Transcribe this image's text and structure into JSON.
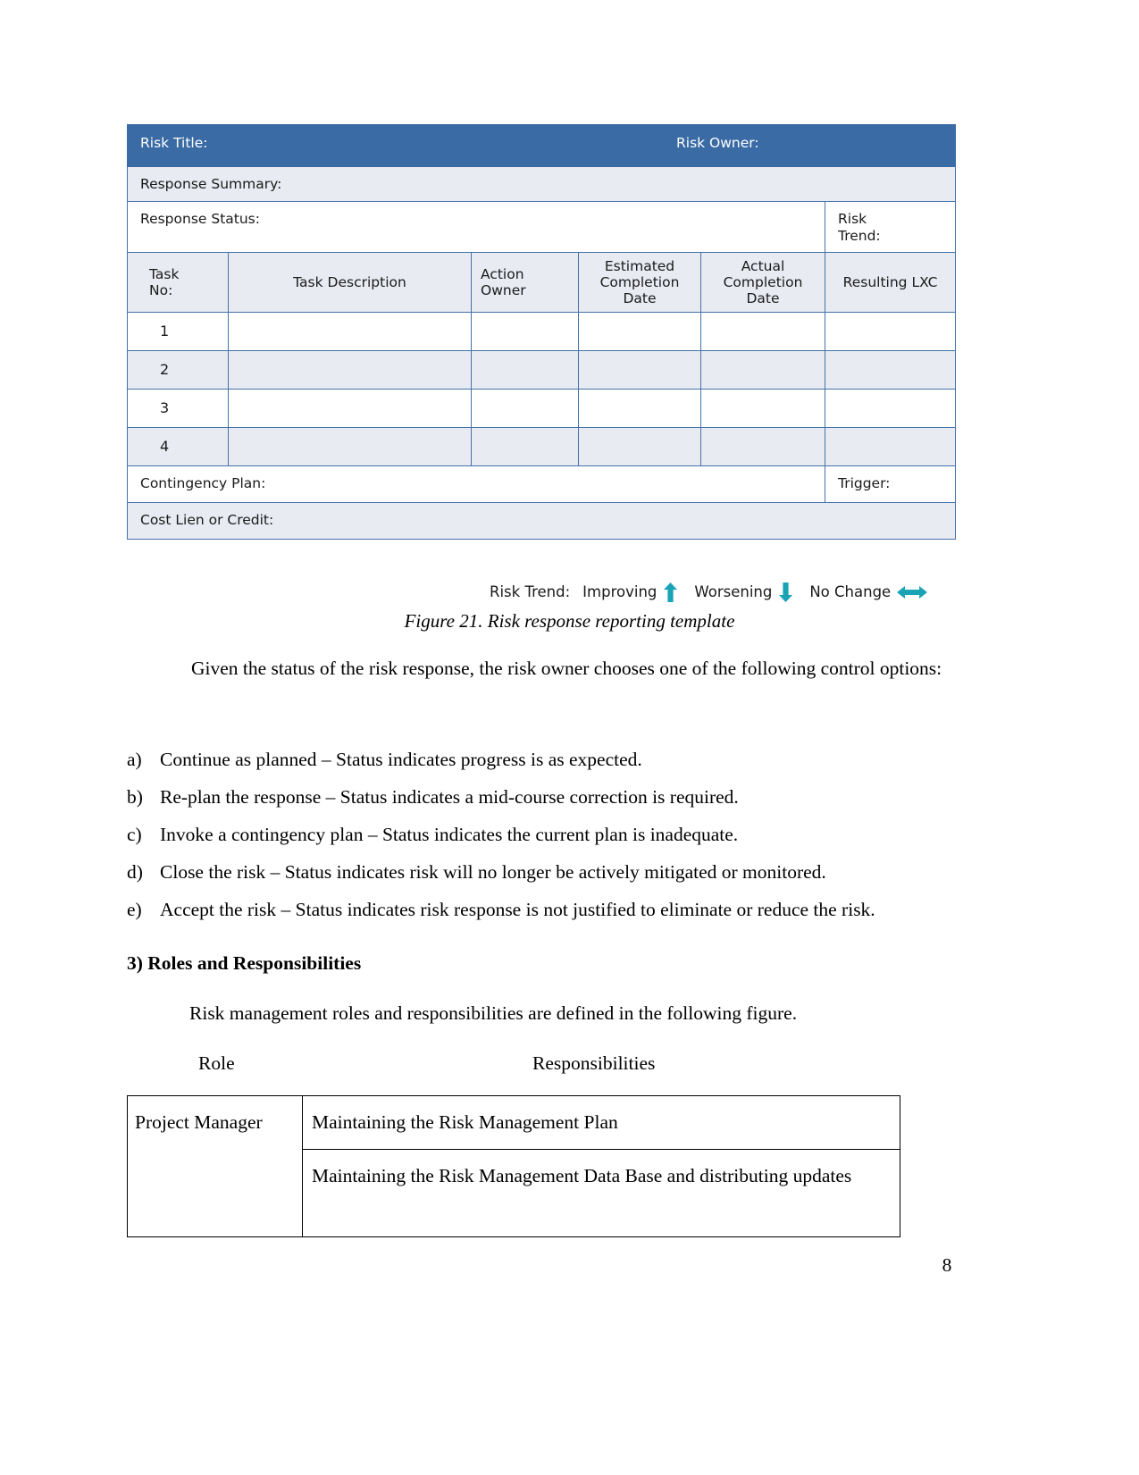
{
  "figure": {
    "table": {
      "header": {
        "risk_title_label": "Risk Title:",
        "risk_owner_label": "Risk Owner:"
      },
      "response_summary_label": "Response Summary:",
      "response_status_label": "Response Status:",
      "risk_trend_label_line1": "Risk",
      "risk_trend_label_line2": "Trend:",
      "columns": {
        "task_no_line1": "Task",
        "task_no_line2": "No:",
        "task_description": "Task  Description",
        "action_owner_line1": "Action",
        "action_owner_line2": "Owner",
        "estimated_line1": "Estimated",
        "estimated_line2": "Completion",
        "estimated_line3": "Date",
        "actual_line1": "Actual",
        "actual_line2": "Completion",
        "actual_line3": "Date",
        "resulting_lxc": "Resulting LXC"
      },
      "task_rows": [
        {
          "no": "1"
        },
        {
          "no": "2"
        },
        {
          "no": "3"
        },
        {
          "no": "4"
        }
      ],
      "contingency_plan_label": "Contingency Plan:",
      "trigger_label": "Trigger:",
      "cost_lien_label": "Cost Lien or Credit:",
      "colors": {
        "header_bg": "#3a6ba5",
        "header_text": "#ffffff",
        "shaded_row_bg": "#e8ebf2",
        "border": "#4472a8"
      }
    },
    "legend": {
      "label": "Risk Trend:",
      "items": [
        {
          "text": "Improving",
          "icon": "arrow-up-icon",
          "color": "#1aa3b5"
        },
        {
          "text": "Worsening",
          "icon": "arrow-down-icon",
          "color": "#1aa3b5"
        },
        {
          "text": "No Change",
          "icon": "arrow-left-right-icon",
          "color": "#1aa3b5"
        }
      ]
    },
    "caption": "Figure 21. Risk response reporting template"
  },
  "body": {
    "intro_paragraph": "Given the status of the risk response, the risk owner chooses one of the following control options:",
    "control_options": [
      {
        "marker": "a)",
        "text": "Continue as planned – Status indicates progress is as expected."
      },
      {
        "marker": "b)",
        "text": "Re-plan the response – Status indicates a mid-course correction is required."
      },
      {
        "marker": "c)",
        "text": "Invoke a contingency plan – Status indicates the current plan is inadequate."
      },
      {
        "marker": "d)",
        "text": "Close the risk – Status indicates risk will no longer be actively mitigated or monitored."
      },
      {
        "marker": "e)",
        "text": "Accept the risk – Status indicates risk response is not justified to eliminate or reduce the risk."
      }
    ],
    "section_heading": "3) Roles and Responsibilities",
    "roles_intro": "Risk management roles and responsibilities are defined in the following figure."
  },
  "roles_table": {
    "headers": {
      "role": "Role",
      "responsibilities": "Responsibilities"
    },
    "rows": [
      {
        "role": "Project Manager",
        "responsibility": "Maintaining the Risk Management Plan"
      },
      {
        "role": "",
        "responsibility": "Maintaining the Risk Management Data Base and distributing updates"
      }
    ]
  },
  "page_number": "8"
}
